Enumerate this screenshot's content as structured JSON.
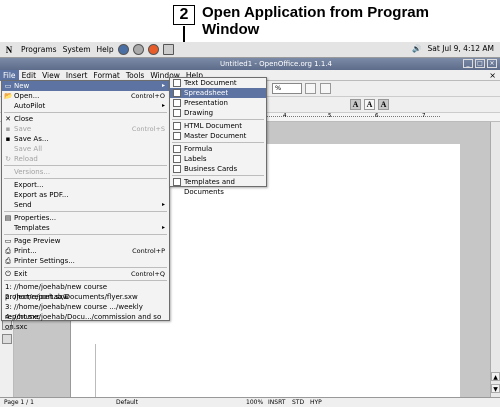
{
  "caption": {
    "step_number": "2",
    "text": "Open Application from Program Window"
  },
  "gnome_panel": {
    "foot_icon": "gnome-foot-icon",
    "menus": [
      "Programs",
      "System",
      "Help"
    ],
    "clock": "Sat Jul  9,  4:12 AM"
  },
  "window": {
    "title": "Untitled1 - OpenOffice.org 1.1.4"
  },
  "menubar": {
    "items": [
      "File",
      "Edit",
      "View",
      "Insert",
      "Format",
      "Tools",
      "Window",
      "Help"
    ]
  },
  "toolbar": {
    "zoom": "%",
    "font_buttons": [
      "A",
      "A",
      "A"
    ]
  },
  "ruler": {
    "marks": [
      "4",
      "5",
      "6",
      "7"
    ]
  },
  "file_menu": {
    "new": "New",
    "open": "Open...",
    "open_shortcut": "Control+O",
    "autopilot": "AutoPilot",
    "close": "Close",
    "save": "Save",
    "save_shortcut": "Control+S",
    "save_as": "Save As...",
    "save_all": "Save All",
    "reload": "Reload",
    "versions": "Versions...",
    "export": "Export...",
    "export_pdf": "Export as PDF...",
    "send": "Send",
    "properties": "Properties...",
    "templates": "Templates",
    "page_preview": "Page Preview",
    "print": "Print...",
    "print_shortcut": "Control+P",
    "printer_settings": "Printer Settings...",
    "exit": "Exit",
    "exit_shortcut": "Control+Q",
    "recent": [
      "1: //home/joehab/new course project/report.sxw",
      "2: /home/joehab/Documents/flyer.sxw",
      "3: //home/joehab/new course .../weekly report.sxc",
      "4: //home/joehab/Docu.../commission and so on.sxc"
    ]
  },
  "new_menu": {
    "text_document": "Text Document",
    "spreadsheet": "Spreadsheet",
    "presentation": "Presentation",
    "drawing": "Drawing",
    "html_document": "HTML Document",
    "master_document": "Master Document",
    "formula": "Formula",
    "labels": "Labels",
    "business_cards": "Business Cards",
    "templates": "Templates and Documents"
  },
  "statusbar": {
    "page": "Page 1 / 1",
    "style": "Default",
    "zoom": "100%",
    "insert": "INSRT",
    "std": "STD",
    "hyp": "HYP"
  }
}
